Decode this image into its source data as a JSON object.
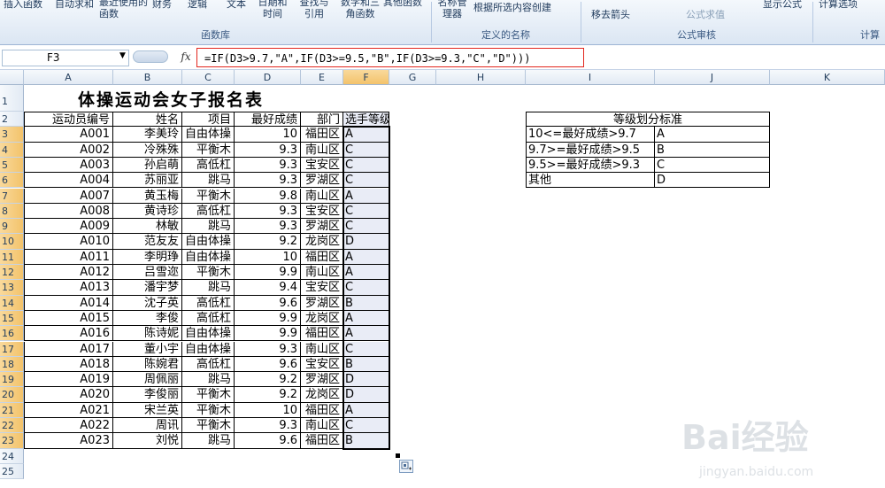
{
  "ribbon": {
    "items": [
      "插入函数",
      "自动求和",
      "最近使用的函数",
      "财务",
      "逻辑",
      "文本",
      "日期和时间",
      "查找与引用",
      "数学和三角函数",
      "其他函数",
      "名称管理器",
      "根据所选内容创建",
      "移去箭头",
      "公式求值",
      "显示公式",
      "计算选项"
    ],
    "groups": [
      "函数库",
      "定义的名称",
      "公式审核",
      "计算"
    ]
  },
  "formula_bar": {
    "name_box": "F3",
    "fx": "fx",
    "formula": "=IF(D3>9.7,\"A\",IF(D3>=9.5,\"B\",IF(D3>=9.3,\"C\",\"D\")))"
  },
  "columns": [
    "A",
    "B",
    "C",
    "D",
    "E",
    "F",
    "G",
    "H",
    "I",
    "J",
    "K"
  ],
  "sheet_title": "体操运动会女子报名表",
  "headers": [
    "运动员编号",
    "姓名",
    "项目",
    "最好成绩",
    "部门",
    "选手等级"
  ],
  "rows": [
    [
      "A001",
      "李美玲",
      "自由体操",
      "10",
      "福田区",
      "A"
    ],
    [
      "A002",
      "冷殊殊",
      "平衡木",
      "9.3",
      "南山区",
      "C"
    ],
    [
      "A003",
      "孙启萌",
      "高低杠",
      "9.3",
      "宝安区",
      "C"
    ],
    [
      "A004",
      "苏丽亚",
      "跳马",
      "9.3",
      "罗湖区",
      "C"
    ],
    [
      "A007",
      "黄玉梅",
      "平衡木",
      "9.8",
      "南山区",
      "A"
    ],
    [
      "A008",
      "黄诗珍",
      "高低杠",
      "9.3",
      "宝安区",
      "C"
    ],
    [
      "A009",
      "林敏",
      "跳马",
      "9.3",
      "罗湖区",
      "C"
    ],
    [
      "A010",
      "范友友",
      "自由体操",
      "9.2",
      "龙岗区",
      "D"
    ],
    [
      "A011",
      "李明琤",
      "自由体操",
      "10",
      "福田区",
      "A"
    ],
    [
      "A012",
      "吕雪迩",
      "平衡木",
      "9.9",
      "南山区",
      "A"
    ],
    [
      "A013",
      "潘宇梦",
      "跳马",
      "9.4",
      "宝安区",
      "C"
    ],
    [
      "A014",
      "沈子英",
      "高低杠",
      "9.6",
      "罗湖区",
      "B"
    ],
    [
      "A015",
      "李俊",
      "高低杠",
      "9.9",
      "龙岗区",
      "A"
    ],
    [
      "A016",
      "陈诗妮",
      "自由体操",
      "9.9",
      "福田区",
      "A"
    ],
    [
      "A017",
      "董小宇",
      "自由体操",
      "9.3",
      "南山区",
      "C"
    ],
    [
      "A018",
      "陈婉君",
      "高低杠",
      "9.6",
      "宝安区",
      "B"
    ],
    [
      "A019",
      "周佩丽",
      "跳马",
      "9.2",
      "罗湖区",
      "D"
    ],
    [
      "A020",
      "李俊丽",
      "平衡木",
      "9.2",
      "龙岗区",
      "D"
    ],
    [
      "A021",
      "宋兰英",
      "平衡木",
      "10",
      "福田区",
      "A"
    ],
    [
      "A022",
      "周讯",
      "平衡木",
      "9.3",
      "南山区",
      "C"
    ],
    [
      "A023",
      "刘悦",
      "跳马",
      "9.6",
      "福田区",
      "B"
    ]
  ],
  "standard": {
    "title": "等级划分标准",
    "rows": [
      [
        "10<=最好成绩>9.7",
        "A"
      ],
      [
        "9.7>=最好成绩>9.5",
        "B"
      ],
      [
        "9.5>=最好成绩>9.3",
        "C"
      ],
      [
        "其他",
        "D"
      ]
    ]
  },
  "watermark": {
    "brand": "Bai经验",
    "url": "jingyan.baidu.com"
  }
}
